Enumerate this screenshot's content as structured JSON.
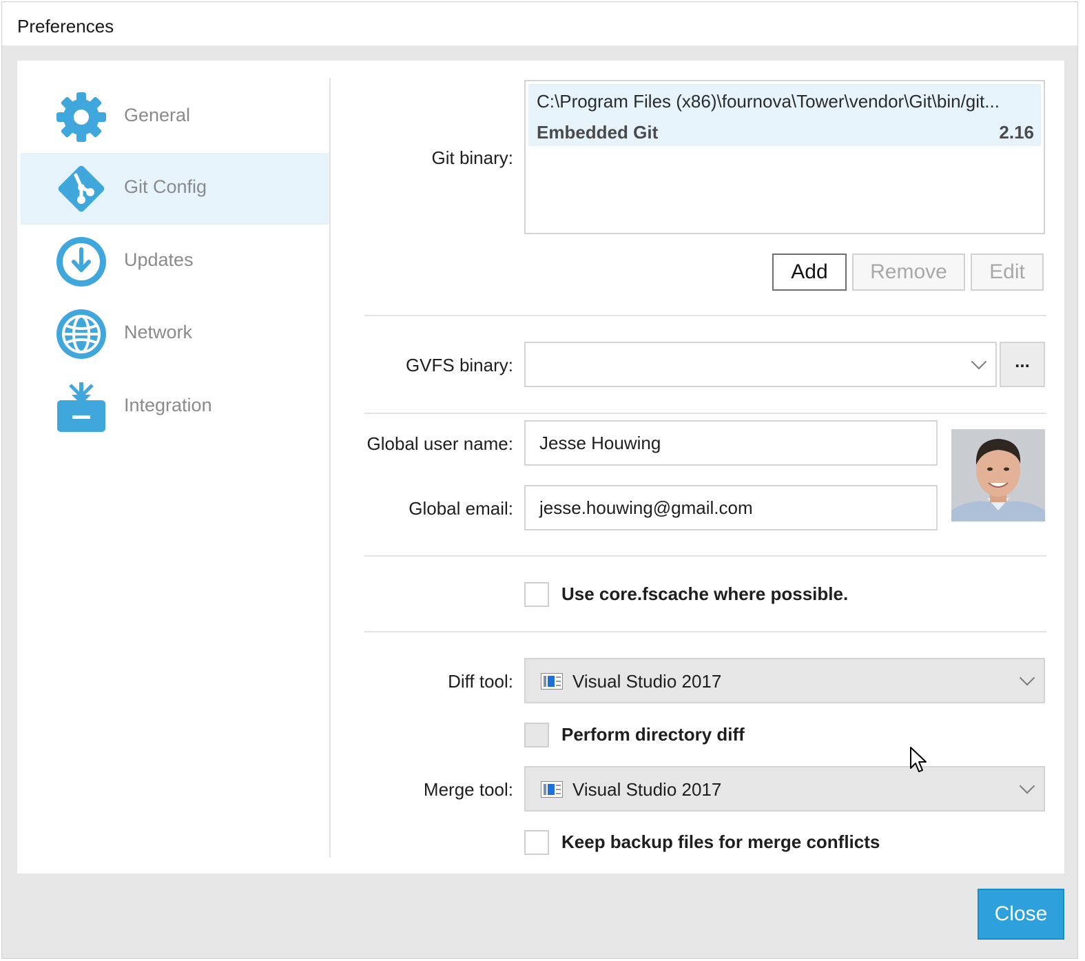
{
  "window": {
    "title": "Preferences"
  },
  "sidebar": {
    "items": [
      {
        "label": "General",
        "icon": "gear-icon",
        "active": false
      },
      {
        "label": "Git Config",
        "icon": "git-icon",
        "active": true
      },
      {
        "label": "Updates",
        "icon": "download-icon",
        "active": false
      },
      {
        "label": "Network",
        "icon": "globe-icon",
        "active": false
      },
      {
        "label": "Integration",
        "icon": "integration-icon",
        "active": false
      }
    ],
    "accent_color": "#3fa7dc",
    "active_bg": "#e6f3fb"
  },
  "git_binary": {
    "label": "Git binary:",
    "entries": [
      {
        "path": "C:\\Program Files (x86)\\fournova\\Tower\\vendor\\Git\\bin/git...",
        "name": "Embedded Git",
        "version": "2.16",
        "selected": true
      }
    ],
    "buttons": {
      "add": "Add",
      "remove": "Remove",
      "edit": "Edit"
    }
  },
  "gvfs": {
    "label": "GVFS binary:",
    "value": "",
    "browse_label": "..."
  },
  "identity": {
    "username_label": "Global user name:",
    "username_value": "Jesse Houwing",
    "email_label": "Global email:",
    "email_value": "jesse.houwing@gmail.com"
  },
  "fscache": {
    "label": "Use core.fscache where possible.",
    "checked": false
  },
  "diff": {
    "label": "Diff tool:",
    "value": "Visual Studio 2017",
    "icon": "visual-studio-icon",
    "directory_diff_label": "Perform directory diff",
    "directory_diff_checked": false
  },
  "merge": {
    "label": "Merge tool:",
    "value": "Visual Studio 2017",
    "icon": "visual-studio-icon",
    "backup_label": "Keep backup files for merge conflicts",
    "backup_checked": false
  },
  "footer": {
    "close_label": "Close",
    "close_color": "#2ea0db"
  }
}
